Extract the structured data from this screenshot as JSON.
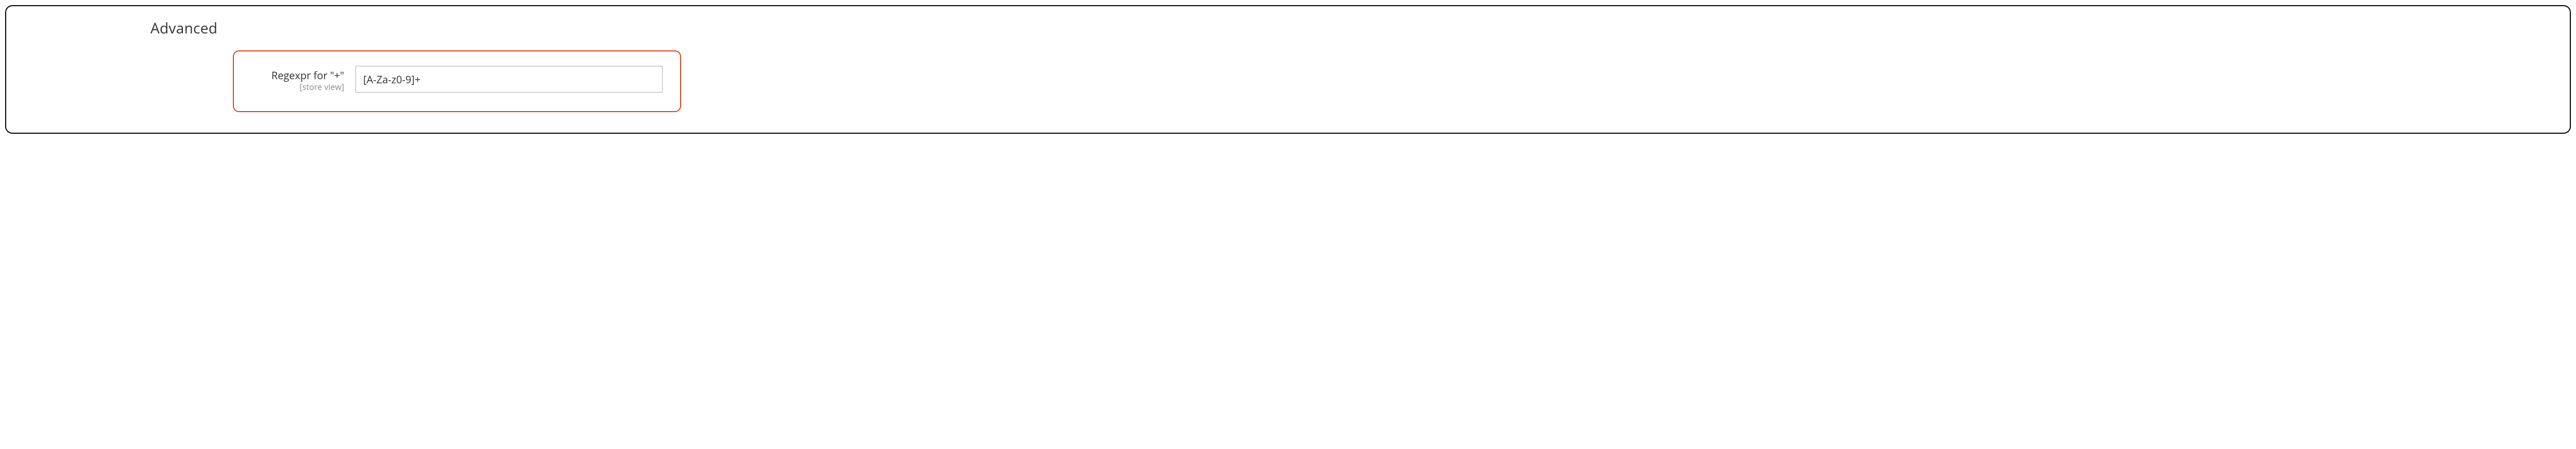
{
  "section": {
    "title": "Advanced"
  },
  "field": {
    "label": "Regexpr for \"+\"",
    "scope": "[store view]",
    "value": "[A-Za-z0-9]+"
  }
}
